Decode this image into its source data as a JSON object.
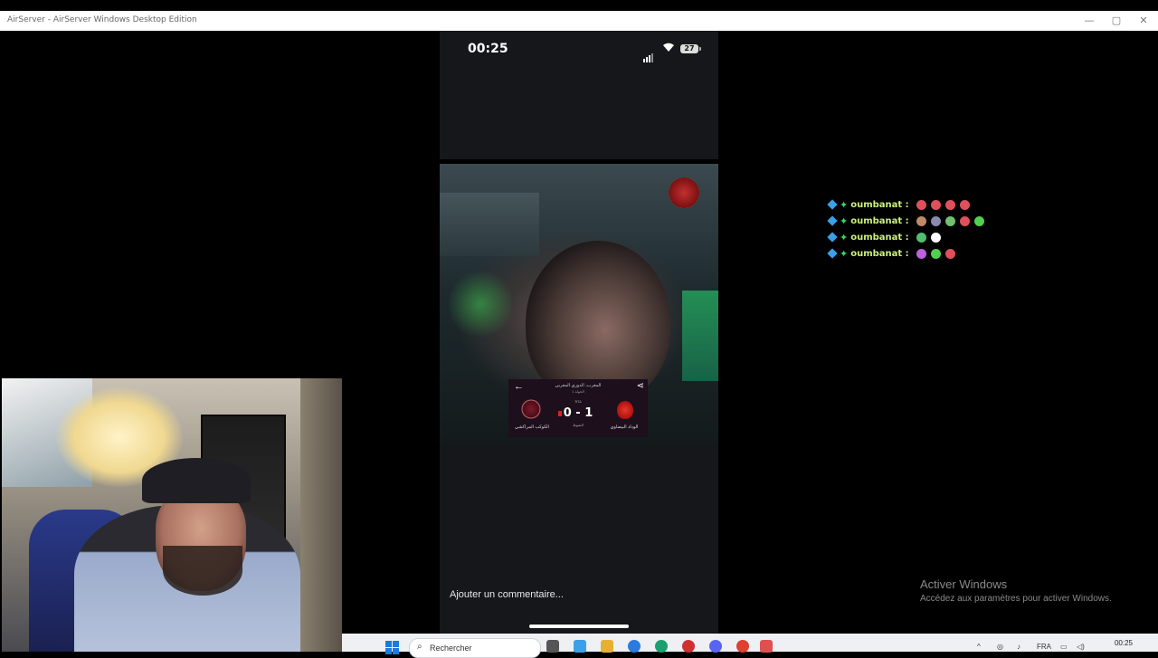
{
  "window": {
    "title": "AirServer - AirServer Windows Desktop Edition",
    "minimize_glyph": "—",
    "maximize_glyph": "▢",
    "close_glyph": "✕"
  },
  "phone": {
    "status_time": "00:25",
    "battery": "27",
    "comment_placeholder": "Ajouter un commentaire..."
  },
  "scoreboard": {
    "league": "المغرب، الدوري المغربي",
    "round": "الجولة 1",
    "minute": "'9'11",
    "score": "0 - 1",
    "home_team": "الكوكب المراكشي",
    "away_team": "الوداد البيضاوي",
    "status": "الشوط"
  },
  "chat": {
    "messages": [
      {
        "user": "oumbanat :",
        "emotes": [
          "#e0505a",
          "#e0505a",
          "#e0505a",
          "#e0505a"
        ]
      },
      {
        "user": "oumbanat :",
        "emotes": [
          "#c08a6a",
          "#8a8ab0",
          "#70c070",
          "#e0505a",
          "#50d050"
        ]
      },
      {
        "user": "oumbanat :",
        "emotes": [
          "#50c070",
          "#ffffff"
        ]
      },
      {
        "user": "oumbanat :",
        "emotes": [
          "#c060e0",
          "#50d050",
          "#e0505a"
        ]
      }
    ]
  },
  "activation": {
    "title": "Activer Windows",
    "subtitle": "Accédez aux paramètres pour activer Windows."
  },
  "taskbar": {
    "search_label": "Rechercher",
    "language": "FRA",
    "clock_time": "00:25"
  },
  "colors": {
    "chat_username": "#ccf27a",
    "start_blue": "#1a7ae0"
  }
}
